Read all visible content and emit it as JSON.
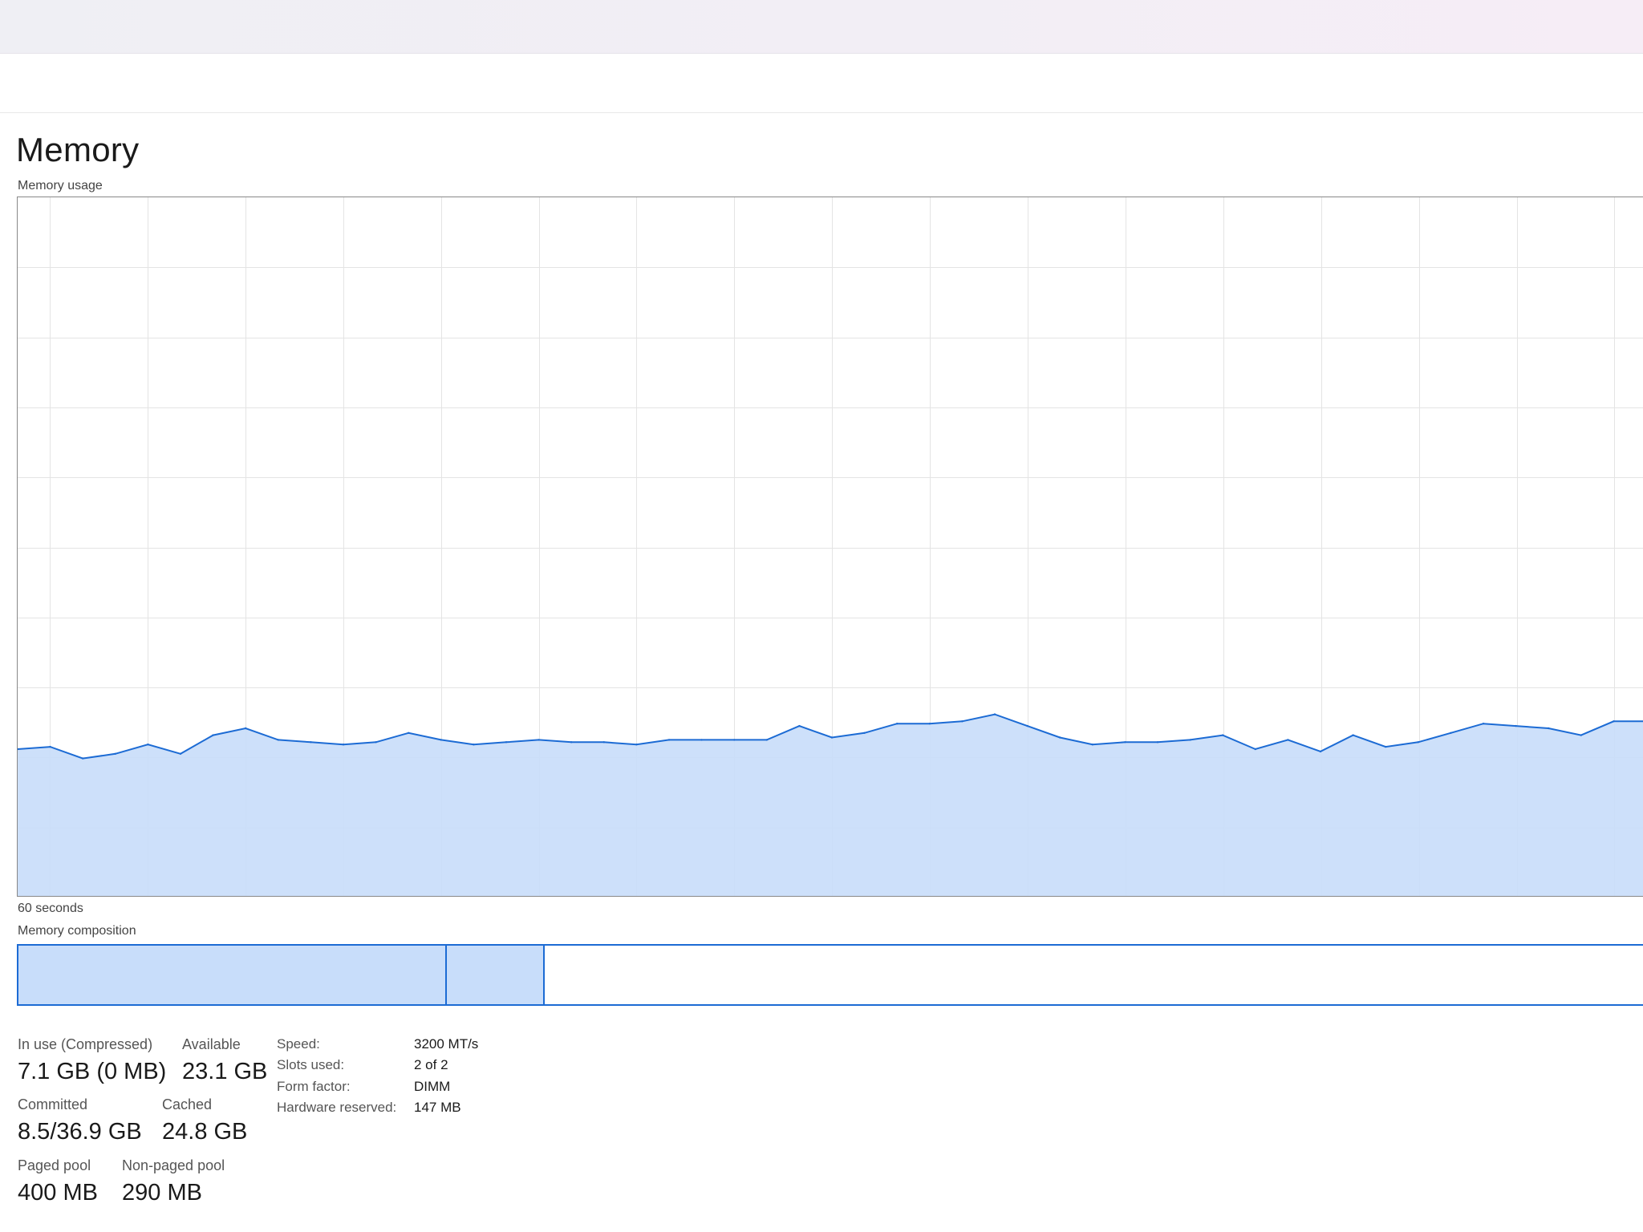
{
  "page_title": "Memory",
  "chart": {
    "label": "Memory usage",
    "time_label": "60 seconds",
    "fill_color": "#c8ddfa",
    "line_color": "#1c6bd4",
    "grid_color": "#e4e4e4"
  },
  "chart_data": {
    "type": "area",
    "ylim": [
      0,
      30.2
    ],
    "x_span_seconds": 60,
    "grid": true,
    "series": [
      {
        "values": [
          6.4,
          6.5,
          6,
          6.2,
          6.6,
          6.2,
          7,
          7.3,
          6.8,
          6.7,
          6.6,
          6.7,
          7.1,
          6.8,
          6.6,
          6.7,
          6.8,
          6.7,
          6.7,
          6.6,
          6.8,
          6.8,
          6.8,
          6.8,
          7.4,
          6.9,
          7.1,
          7.5,
          7.5,
          7.6,
          7.9,
          7.4,
          6.9,
          6.6,
          6.7,
          6.7,
          6.8,
          7,
          6.4,
          6.8,
          6.3,
          7,
          6.5,
          6.7,
          7.1,
          7.5,
          7.4,
          7.3,
          7,
          7.6,
          7.6
        ]
      }
    ]
  },
  "composition": {
    "label": "Memory composition",
    "border_color": "#1c6bd4"
  },
  "stats": {
    "in_use_label": "In use (Compressed)",
    "in_use_value": "7.1 GB (0 MB)",
    "available_label": "Available",
    "available_value": "23.1 GB",
    "committed_label": "Committed",
    "committed_value": "8.5/36.9 GB",
    "cached_label": "Cached",
    "cached_value": "24.8 GB",
    "paged_label": "Paged pool",
    "paged_value": "400 MB",
    "nonpaged_label": "Non-paged pool",
    "nonpaged_value": "290 MB"
  },
  "details": {
    "speed_label": "Speed:",
    "speed_value": "3200 MT/s",
    "slots_label": "Slots used:",
    "slots_value": "2 of 2",
    "form_label": "Form factor:",
    "form_value": "DIMM",
    "reserved_label": "Hardware reserved:",
    "reserved_value": "147 MB"
  }
}
